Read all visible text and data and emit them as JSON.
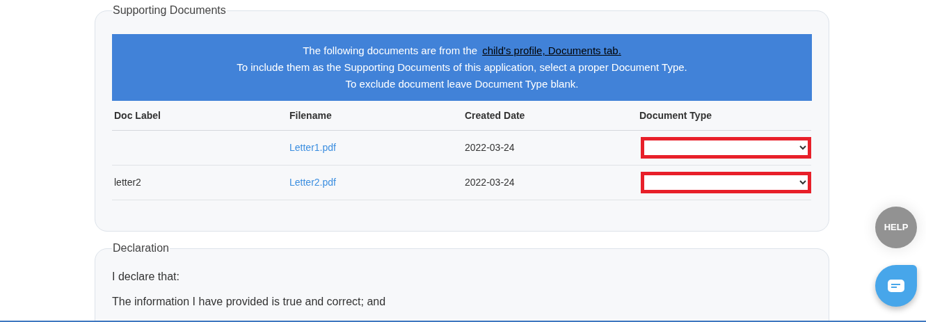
{
  "supporting_documents": {
    "legend": "Supporting Documents",
    "notice": {
      "line_1": "The following documents are from the",
      "link": "child's profile, Documents tab.",
      "line_2": "To include them as the Supporting Documents of this application, select a proper Document Type.",
      "line_3": "To exclude document leave Document Type blank."
    },
    "table": {
      "columns": [
        "Doc Label",
        "Filename",
        "Created Date",
        "Document Type"
      ],
      "rows": [
        {
          "doc_label": "",
          "filename": "Letter1.pdf",
          "created_date": "2022-03-24",
          "document_type": {
            "invalid": true
          }
        },
        {
          "doc_label": "letter2",
          "filename": "Letter2.pdf",
          "created_date": "2022-03-24",
          "document_type": {
            "invalid": true
          }
        }
      ]
    }
  },
  "declaration": {
    "legend": "Declaration",
    "paragraphs": [
      "I declare that:",
      "The information I have provided is true and correct; and"
    ]
  },
  "help_button": "HELP"
}
